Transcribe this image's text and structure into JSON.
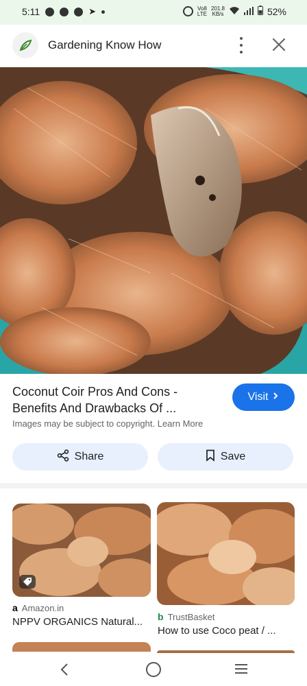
{
  "status_bar": {
    "time": "5:11",
    "network_speed": "201.8",
    "network_unit": "KB/s",
    "volte": "Vo8",
    "lte": "LTE",
    "battery": "52%"
  },
  "header": {
    "site_title": "Gardening Know How",
    "icons": [
      "site-logo-icon",
      "more-vert-icon",
      "close-icon"
    ]
  },
  "caption": {
    "title": "Coconut Coir Pros And Cons - Benefits And Drawbacks Of ...",
    "visit_label": "Visit",
    "copyright": "Images may be subject to copyright. Learn More"
  },
  "actions": {
    "share_label": "Share",
    "save_label": "Save"
  },
  "related": [
    {
      "source": "Amazon.in",
      "title": "NPPV ORGANICS Natural..."
    },
    {
      "source": "TrustBasket",
      "title": "How to use Coco peat / ..."
    }
  ],
  "colors": {
    "accent": "#1a73e8",
    "button_bg": "#e8f0fe",
    "status_bar_bg": "#ecf7ec"
  }
}
